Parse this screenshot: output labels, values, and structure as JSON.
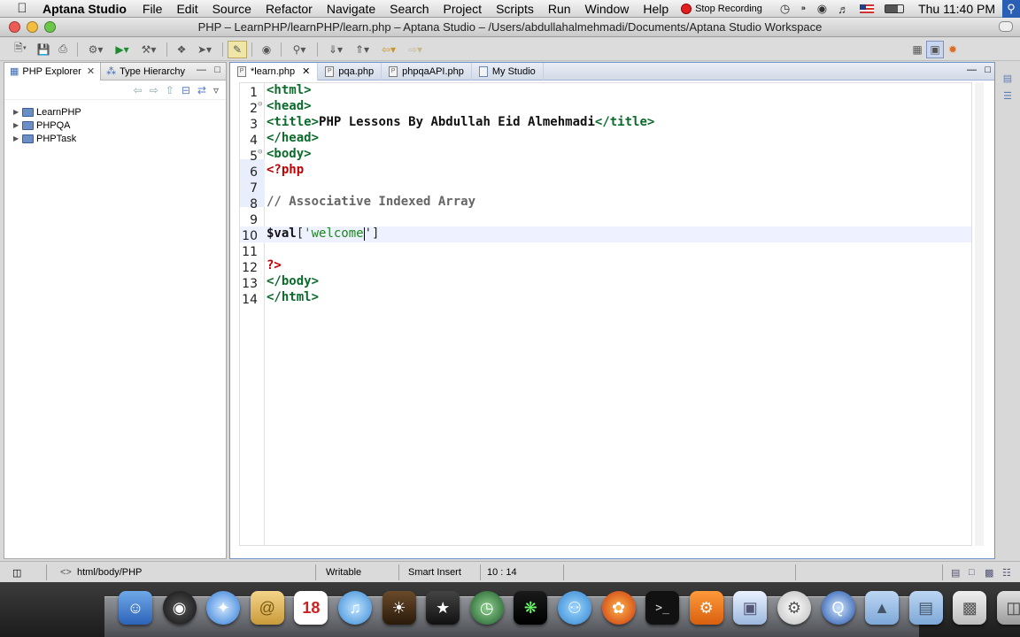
{
  "menubar": {
    "apple_icon": "apple-icon",
    "app_name": "Aptana Studio",
    "menus": [
      "File",
      "Edit",
      "Source",
      "Refactor",
      "Navigate",
      "Search",
      "Project",
      "Scripts",
      "Run",
      "Window",
      "Help"
    ],
    "recording_label": "Stop Recording",
    "clock": "Thu 11:40 PM"
  },
  "window": {
    "title": "PHP – LearnPHP/learnPHP/learn.php – Aptana Studio – /Users/abdullahalmehmadi/Documents/Aptana Studio Workspace"
  },
  "left_panel": {
    "tabs": [
      {
        "label": "PHP Explorer",
        "active": true
      },
      {
        "label": "Type Hierarchy",
        "active": false
      }
    ],
    "tree": [
      {
        "label": "LearnPHP"
      },
      {
        "label": "PHPQA"
      },
      {
        "label": "PHPTask"
      }
    ]
  },
  "editor": {
    "tabs": [
      {
        "label": "*learn.php",
        "active": true
      },
      {
        "label": "pqa.php",
        "active": false
      },
      {
        "label": "phpqaAPI.php",
        "active": false
      },
      {
        "label": "My Studio",
        "active": false
      }
    ],
    "line_numbers": [
      "1",
      "2",
      "3",
      "4",
      "5",
      "6",
      "7",
      "8",
      "9",
      "10",
      "11",
      "12",
      "13",
      "14"
    ],
    "code": {
      "l1": "<html>",
      "l2": "<head>",
      "l3_open": "<title>",
      "l3_text": "PHP Lessons By Abdullah Eid Almehmadi",
      "l3_close": "</title>",
      "l4": "</head>",
      "l5": "<body>",
      "l6": "<?php",
      "l8": "// Associative Indexed Array",
      "l10_var": "$val",
      "l10_open": "[",
      "l10_str": "'welcome",
      "l10_close": "']",
      "l12": "?>",
      "l13": "</body>",
      "l14": "</html>"
    }
  },
  "statusbar": {
    "breadcrumb": "html/body/PHP",
    "mode": "Writable",
    "insert": "Smart Insert",
    "position": "10 : 14"
  },
  "colors": {
    "accent": "#6f93c8",
    "tag_green": "#0b6b2b",
    "php_red": "#c00000",
    "string_green": "#1a8a1a"
  }
}
